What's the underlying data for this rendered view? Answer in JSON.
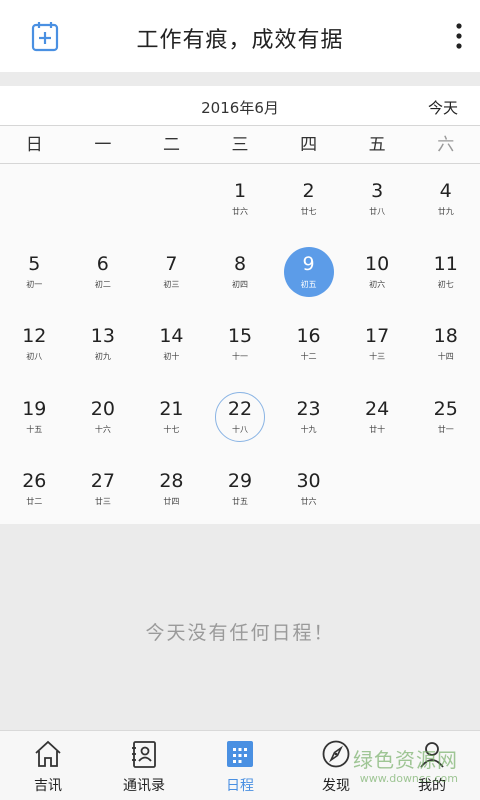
{
  "header": {
    "title": "工作有痕，成效有据"
  },
  "calendar": {
    "month_title": "2016年6月",
    "today_label": "今天",
    "weekdays": [
      "日",
      "一",
      "二",
      "三",
      "四",
      "五",
      "六"
    ],
    "days": [
      {
        "num": "1",
        "lunar": "廿六",
        "col": 3,
        "row": 0
      },
      {
        "num": "2",
        "lunar": "廿七",
        "col": 4,
        "row": 0
      },
      {
        "num": "3",
        "lunar": "廿八",
        "col": 5,
        "row": 0
      },
      {
        "num": "4",
        "lunar": "廿九",
        "col": 6,
        "row": 0
      },
      {
        "num": "5",
        "lunar": "初一",
        "col": 0,
        "row": 1
      },
      {
        "num": "6",
        "lunar": "初二",
        "col": 1,
        "row": 1
      },
      {
        "num": "7",
        "lunar": "初三",
        "col": 2,
        "row": 1
      },
      {
        "num": "8",
        "lunar": "初四",
        "col": 3,
        "row": 1
      },
      {
        "num": "9",
        "lunar": "初五",
        "col": 4,
        "row": 1,
        "state": "selected"
      },
      {
        "num": "10",
        "lunar": "初六",
        "col": 5,
        "row": 1
      },
      {
        "num": "11",
        "lunar": "初七",
        "col": 6,
        "row": 1
      },
      {
        "num": "12",
        "lunar": "初八",
        "col": 0,
        "row": 2
      },
      {
        "num": "13",
        "lunar": "初九",
        "col": 1,
        "row": 2
      },
      {
        "num": "14",
        "lunar": "初十",
        "col": 2,
        "row": 2
      },
      {
        "num": "15",
        "lunar": "十一",
        "col": 3,
        "row": 2
      },
      {
        "num": "16",
        "lunar": "十二",
        "col": 4,
        "row": 2
      },
      {
        "num": "17",
        "lunar": "十三",
        "col": 5,
        "row": 2
      },
      {
        "num": "18",
        "lunar": "十四",
        "col": 6,
        "row": 2
      },
      {
        "num": "19",
        "lunar": "十五",
        "col": 0,
        "row": 3
      },
      {
        "num": "20",
        "lunar": "十六",
        "col": 1,
        "row": 3
      },
      {
        "num": "21",
        "lunar": "十七",
        "col": 2,
        "row": 3
      },
      {
        "num": "22",
        "lunar": "十八",
        "col": 3,
        "row": 3,
        "state": "today"
      },
      {
        "num": "23",
        "lunar": "十九",
        "col": 4,
        "row": 3
      },
      {
        "num": "24",
        "lunar": "廿十",
        "col": 5,
        "row": 3
      },
      {
        "num": "25",
        "lunar": "廿一",
        "col": 6,
        "row": 3
      },
      {
        "num": "26",
        "lunar": "廿二",
        "col": 0,
        "row": 4
      },
      {
        "num": "27",
        "lunar": "廿三",
        "col": 1,
        "row": 4
      },
      {
        "num": "28",
        "lunar": "廿四",
        "col": 2,
        "row": 4
      },
      {
        "num": "29",
        "lunar": "廿五",
        "col": 3,
        "row": 4
      },
      {
        "num": "30",
        "lunar": "廿六",
        "col": 4,
        "row": 4
      }
    ]
  },
  "empty_message": "今天没有任何日程！",
  "tabs": [
    {
      "label": "吉讯",
      "icon": "home-icon"
    },
    {
      "label": "通讯录",
      "icon": "contacts-icon"
    },
    {
      "label": "日程",
      "icon": "calendar-icon",
      "active": true
    },
    {
      "label": "发现",
      "icon": "compass-icon"
    },
    {
      "label": "我的",
      "icon": "person-icon"
    }
  ],
  "colors": {
    "accent": "#5c9ce8",
    "active_tab": "#4a90e2",
    "today_ring": "#8ab4e4"
  },
  "watermark": {
    "main": "绿色资源网",
    "sub": "www.downcc.com"
  }
}
